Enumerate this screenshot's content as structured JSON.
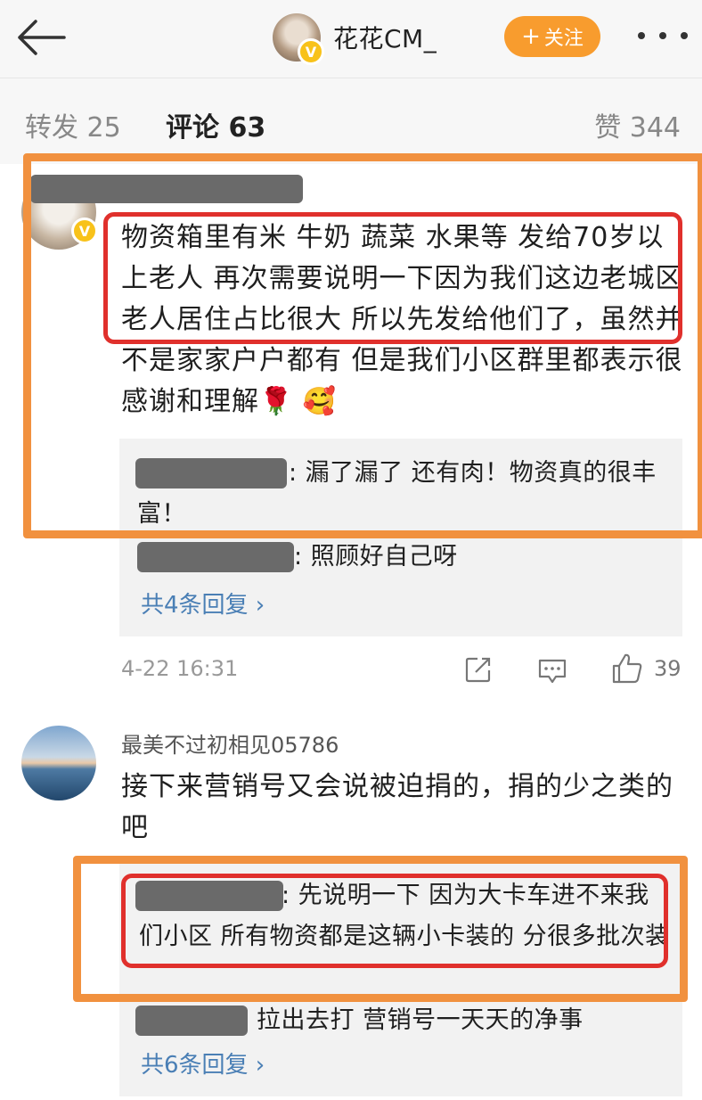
{
  "header": {
    "username": "花花CM_",
    "verified_badge": "V",
    "follow_label": "关注",
    "follow_plus": "+",
    "colors": {
      "follow_button": "#f89c2e",
      "verified": "#f8c21a"
    }
  },
  "tabs": {
    "repost": "转发 25",
    "comment": "评论 63",
    "like": "赞 344"
  },
  "comments": [
    {
      "text": "物资箱里有米 牛奶 蔬菜 水果等 发给70岁以上老人 再次需要说明一下因为我们这边老城区老人居住占比很大 所以先发给他们了，虽然并不是家家户户都有 但是我们小区群里都表示很感谢和理解🌹 🥰",
      "replies": [
        {
          "text": ": 漏了漏了 还有肉！物资真的很丰富！"
        },
        {
          "text": ": 照顾好自己呀"
        }
      ],
      "more_replies": "共4条回复 ›",
      "time": "4-22 16:31",
      "likes": "39"
    },
    {
      "author": "最美不过初相见05786",
      "text": "接下来营销号又会说被迫捐的，捐的少之类的吧",
      "replies": [
        {
          "text": ": 先说明一下 因为大卡车进不来我们小区 所有物资都是这辆小卡装的 分很多批次装"
        },
        {
          "text": "拉出去打  营销号一天天的净事"
        }
      ],
      "more_replies": "共6条回复 ›"
    }
  ],
  "annotation_colors": {
    "orange": "#f1913f",
    "red": "#e0302c"
  }
}
